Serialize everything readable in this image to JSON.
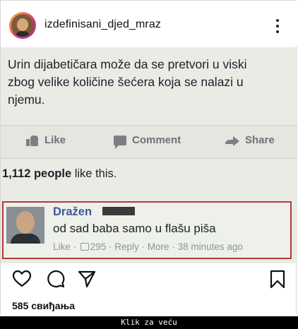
{
  "header": {
    "username": "izdefinisani_djed_mraz",
    "avatar_icon": "profile-photo",
    "more_icon": "more-vertical-icon"
  },
  "post_image": {
    "post_text": "Urin dijabetičara može da se pretvori u viski zbog velike količine šećera koja se nalazi u njemu.",
    "actions": {
      "like": "Like",
      "comment": "Comment",
      "share": "Share"
    },
    "likes": {
      "count": "1,112 people",
      "suffix": " like this."
    },
    "comment": {
      "author": "Dražen",
      "text": "od sad baba samo u flašu piša",
      "meta_like": "Like",
      "meta_count": "295",
      "meta_reply": "Reply",
      "meta_more": "More",
      "meta_time": "38 minutes ago",
      "highlight_color": "#b23b3b"
    }
  },
  "ig_actions": {
    "icons": [
      "heart-icon",
      "comment-icon",
      "send-icon",
      "bookmark-icon"
    ],
    "likes_label": "585 свиђања"
  },
  "footer": {
    "caption": "Klik za veću"
  }
}
